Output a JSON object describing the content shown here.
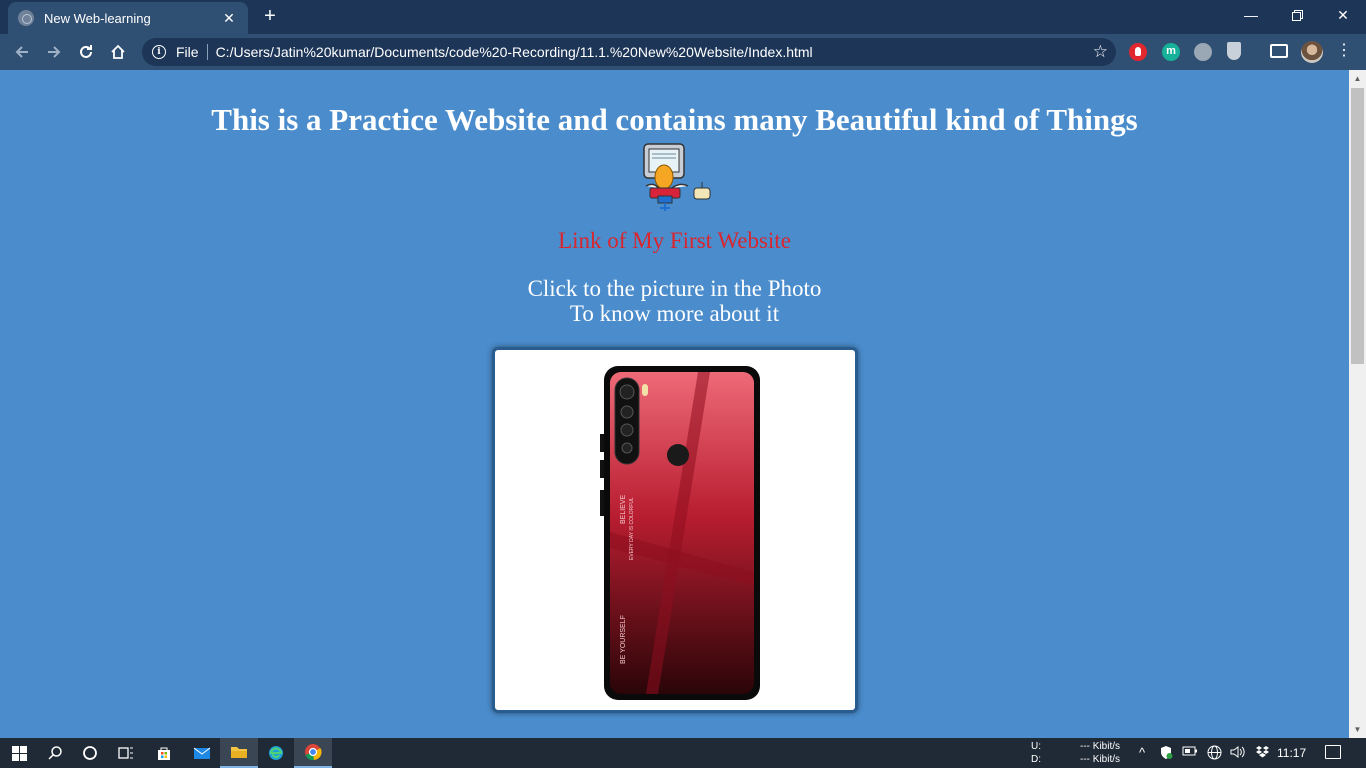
{
  "browser": {
    "tab_title": "New Web-learning",
    "omnibox_scheme_label": "File",
    "omnibox_url": "C:/Users/Jatin%20kumar/Documents/code%20-Recording/11.1.%20New%20Website/Index.html",
    "extension_m_label": "m"
  },
  "page": {
    "title": "This is a Practice Website and contains many Beautiful kind of Things",
    "link_text": "Link of My First Website",
    "instruction_line1": "Click to the picture in the Photo",
    "instruction_line2": "To know more about it",
    "phone_text": {
      "believe": "BELIEVE",
      "every_day": "EVERY DAY IS COLORFUL",
      "be_yourself": "BE YOURSELF"
    },
    "colors": {
      "background": "#4a8ccc",
      "link": "#d9262e",
      "text": "#ffffff"
    }
  },
  "taskbar": {
    "net_up_label": "U:",
    "net_down_label": "D:",
    "net_up_value": "--- Kibit/s",
    "net_down_value": "--- Kibit/s",
    "clock": "11:17",
    "apps": [
      "start",
      "search",
      "cortana",
      "task-view",
      "store",
      "mail",
      "file-explorer",
      "edge",
      "chrome"
    ]
  }
}
